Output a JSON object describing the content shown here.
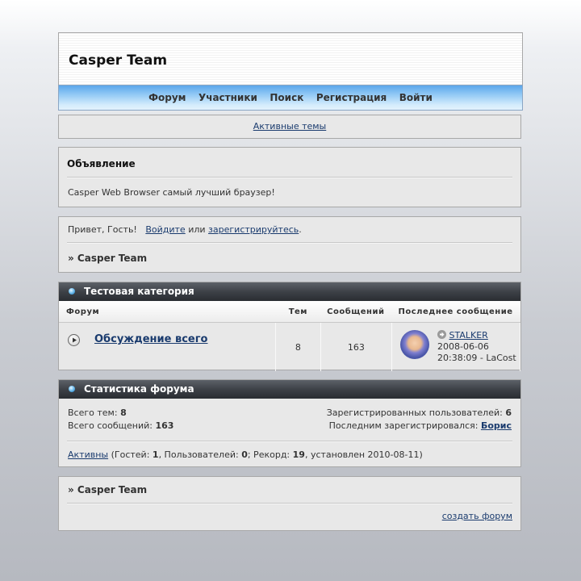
{
  "header": {
    "logo": "Casper Team"
  },
  "nav": {
    "items": [
      "Форум",
      "Участники",
      "Поиск",
      "Регистрация",
      "Войти"
    ]
  },
  "active_topics": {
    "label": "Активные темы"
  },
  "announcement": {
    "title": "Объявление",
    "text": "Casper Web Browser самый лучший браузер!"
  },
  "welcome": {
    "greeting": "Привет, Гость!",
    "login": "Войдите",
    "or": "или",
    "register": "зарегистрируйтесь",
    "dot": ".",
    "breadcrumb": "» Casper Team"
  },
  "category": {
    "title": "Тестовая категория",
    "columns": {
      "forum": "Форум",
      "topics": "Тем",
      "posts": "Сообщений",
      "last": "Последнее сообщение"
    },
    "row": {
      "name": "Обсуждение всего",
      "topics": "8",
      "posts": "163",
      "last_user": "STALKER",
      "last_date": "2008-06-06",
      "last_time": "20:38:09 - LaCost"
    }
  },
  "stats": {
    "title": "Статистика форума",
    "topics_label": "Всего тем:",
    "topics_value": "8",
    "posts_label": "Всего сообщений:",
    "posts_value": "163",
    "users_label": "Зарегистрированных пользователей:",
    "users_value": "6",
    "last_reg_label": "Последним зарегистрировался:",
    "last_reg_value": "Борис",
    "active_link": "Активны",
    "guests_pre": "(Гостей:",
    "guests": "1",
    "users_pre": ", Пользователей:",
    "users": "0",
    "record_pre": "; Рекорд:",
    "record": "19",
    "record_post": ", установлен 2010-08-11)"
  },
  "footer": {
    "breadcrumb": "» Casper Team",
    "create_forum": "создать форум"
  }
}
